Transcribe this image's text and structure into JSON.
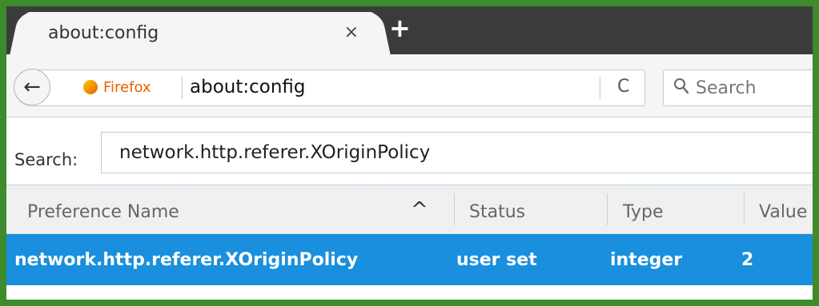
{
  "tab": {
    "title": "about:config",
    "close": "×",
    "new_tab": "+"
  },
  "nav": {
    "back": "←",
    "identity_label": "Firefox",
    "url": "about:config",
    "reload": "C",
    "search_placeholder": "Search"
  },
  "config": {
    "search_label": "Search:",
    "filter_value": "network.http.referer.XOriginPolicy",
    "columns": [
      "Preference Name",
      "Status",
      "Type",
      "Value"
    ],
    "sort_indicator": "^",
    "rows": [
      {
        "name": "network.http.referer.XOriginPolicy",
        "status": "user set",
        "type": "integer",
        "value": "2"
      }
    ]
  },
  "colors": {
    "selection": "#1a8fdd",
    "brand": "#e66000",
    "frame": "#3d8b2a"
  }
}
